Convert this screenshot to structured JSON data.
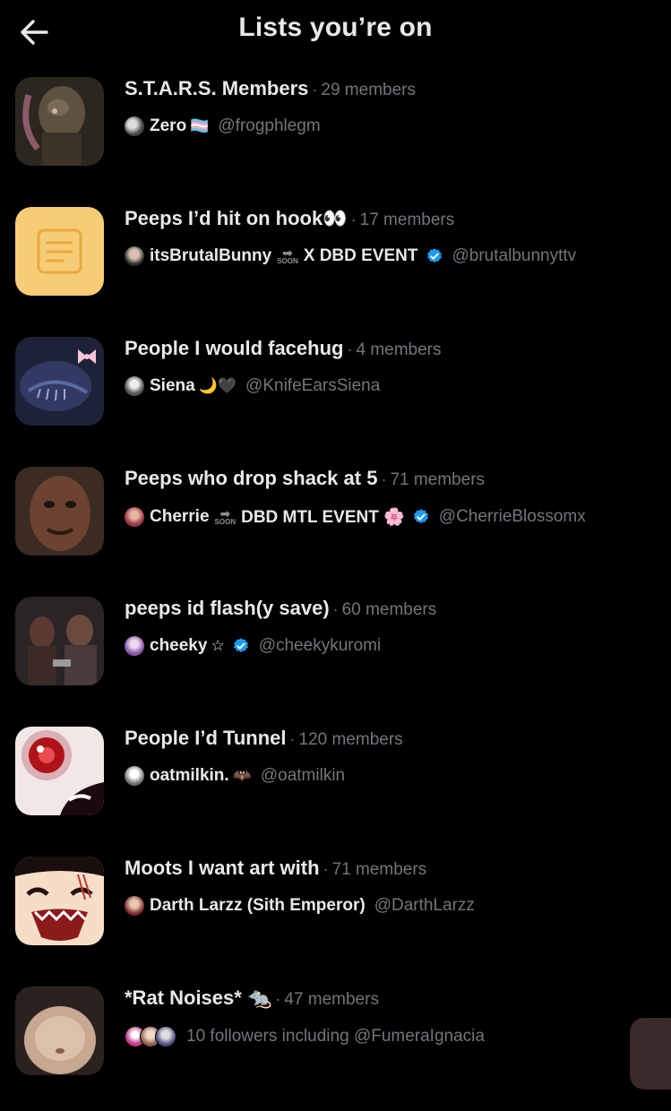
{
  "header": {
    "title": "Lists you’re on",
    "back_label": "Back"
  },
  "lists": [
    {
      "name": "S.T.A.R.S. Members",
      "members": "29 members",
      "owner": {
        "name": "Zero",
        "suffix": "🏳️‍⚧️",
        "extra": "",
        "handle": "@frogphlegm",
        "verified": false
      }
    },
    {
      "name": "Peeps I’d hit on hook👀",
      "members": "17 members",
      "owner": {
        "name": "itsBrutalBunny",
        "suffix": "",
        "extra": "X DBD EVENT",
        "handle": "@brutalbunnyttv",
        "verified": true
      }
    },
    {
      "name": "People I would facehug",
      "members": "4 members",
      "owner": {
        "name": "Siena",
        "suffix": "🌙🖤",
        "extra": "",
        "handle": "@KnifeEarsSiena",
        "verified": false
      }
    },
    {
      "name": "Peeps who drop shack at 5",
      "members": "71 members",
      "owner": {
        "name": "Cherrie",
        "suffix": "",
        "extra": "DBD MTL EVENT 🌸",
        "handle": "@CherrieBlossomx",
        "verified": true
      }
    },
    {
      "name": "peeps id flash(y save)",
      "members": "60 members",
      "owner": {
        "name": "cheeky",
        "suffix": "☆",
        "extra": "",
        "handle": "@cheekykuromi",
        "verified": true
      }
    },
    {
      "name": "People I’d Tunnel",
      "members": "120 members",
      "owner": {
        "name": "oatmilkin.",
        "suffix": "🦇",
        "extra": "",
        "handle": "@oatmilkin",
        "verified": false
      }
    },
    {
      "name": "Moots I want art with",
      "members": "71 members",
      "owner": {
        "name": "Darth Larzz (Sith Emperor)",
        "suffix": "",
        "extra": "",
        "handle": "@DarthLarzz",
        "verified": false
      }
    },
    {
      "name": "*Rat Noises* 🐀",
      "members": "47 members",
      "followers_text": "10 followers including @FumeraIgnacia"
    }
  ],
  "soon_label": "SOON",
  "icons": {
    "back": "arrow-left-icon",
    "verified": "verified-badge-icon",
    "list": "list-document-icon"
  },
  "colors": {
    "background": "#000000",
    "text": "#e7e9ea",
    "secondary": "#71767b",
    "verified": "#1d9bf0",
    "list_icon_bg": "#f6cc77"
  }
}
